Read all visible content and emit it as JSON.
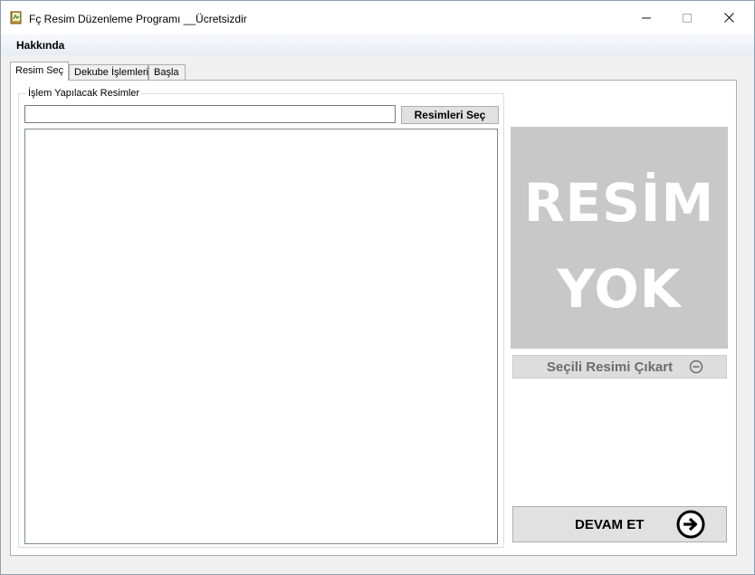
{
  "window": {
    "title": "Fç Resim Düzenleme Programı __Ücretsizdir",
    "minimize_glyph": "—",
    "maximize_glyph": "☐",
    "close_glyph": "✕",
    "app_icon": "book-icon"
  },
  "menubar": {
    "items": [
      {
        "label": "Hakkında"
      }
    ]
  },
  "tabs": [
    {
      "label": "Resim Seç",
      "active": true
    },
    {
      "label": "Dekube İşlemleri",
      "active": false
    },
    {
      "label": "Başla",
      "active": false
    }
  ],
  "images_group": {
    "legend": "İşlem Yapılacak Resimler",
    "path_value": "",
    "select_button": "Resimleri Seç",
    "list_items": []
  },
  "preview": {
    "line1": "RESİM",
    "line2": "YOK",
    "background": "#c8c8c8",
    "text_color": "#ffffff"
  },
  "remove_button": {
    "label": "Seçili Resimi Çıkart",
    "icon": "minus-circle-icon",
    "text_color": "#6d6d6d"
  },
  "continue_button": {
    "label": "DEVAM ET",
    "icon": "arrow-right-circle-icon"
  }
}
